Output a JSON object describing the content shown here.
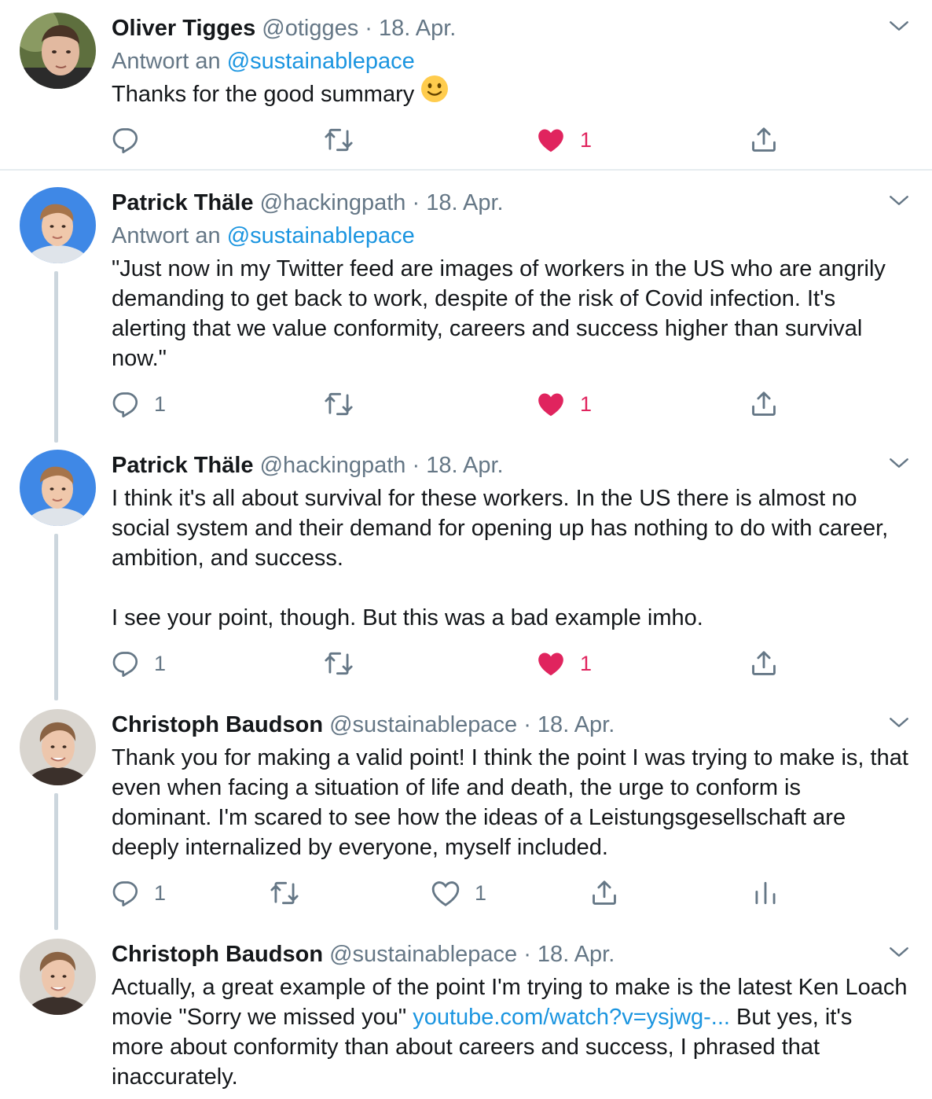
{
  "tweets": [
    {
      "name": "Oliver Tigges",
      "handle": "@otigges",
      "date": "· 18. Apr.",
      "reply_prefix": "Antwort an",
      "reply_to": "@sustainablepace",
      "text": "Thanks for the good summary",
      "emoji": "slightly-smiling-face-icon",
      "replies": "",
      "likes": "1",
      "liked": true
    },
    {
      "name": "Patrick Thäle",
      "handle": "@hackingpath",
      "date": "· 18. Apr.",
      "reply_prefix": "Antwort an",
      "reply_to": "@sustainablepace",
      "text": "\"Just now in my Twitter feed are images of workers in the US who are angrily\ndemanding to get back to work, despite of the risk of Covid infection. It's\nalerting that we value conformity, careers and success higher than survival\nnow.\"",
      "replies": "1",
      "likes": "1",
      "liked": true
    },
    {
      "name": "Patrick Thäle",
      "handle": "@hackingpath",
      "date": "· 18. Apr.",
      "text": "I think it's all about survival for these workers. In the US there is almost no\nsocial system and their demand for opening up has nothing to do with career,\nambition, and success.\n\nI see your point, though. But this was a bad example imho.",
      "replies": "1",
      "likes": "1",
      "liked": true
    },
    {
      "name": "Christoph Baudson",
      "handle": "@sustainablepace",
      "date": "· 18. Apr.",
      "text": "Thank you for making a valid point! I think the point I was trying to make is, that\neven when facing a situation of life and death, the urge to conform is\ndominant. I'm scared to see how the ideas of a Leistungsgesellschaft are\ndeeply internalized by everyone, myself included.",
      "replies": "1",
      "likes": "1",
      "liked": false
    },
    {
      "name": "Christoph Baudson",
      "handle": "@sustainablepace",
      "date": "· 18. Apr.",
      "text_a": "Actually, a great example of the point I'm trying to make is the latest Ken Loach\nmovie \"Sorry we missed you\" ",
      "link": "youtube.com/watch?v=ysjwg-...",
      "text_b": " But yes, it's\nmore about conformity than about careers and success, I phrased that\ninaccurately."
    }
  ],
  "colors": {
    "text": "#14171a",
    "secondary": "#657786",
    "link": "#1b95e0",
    "like": "#e0245e",
    "divider": "#e6ecf0",
    "thread": "#ccd6dd"
  },
  "icons": [
    "reply-icon",
    "retweet-icon",
    "like-icon",
    "share-icon",
    "analytics-icon",
    "chevron-down-icon"
  ]
}
